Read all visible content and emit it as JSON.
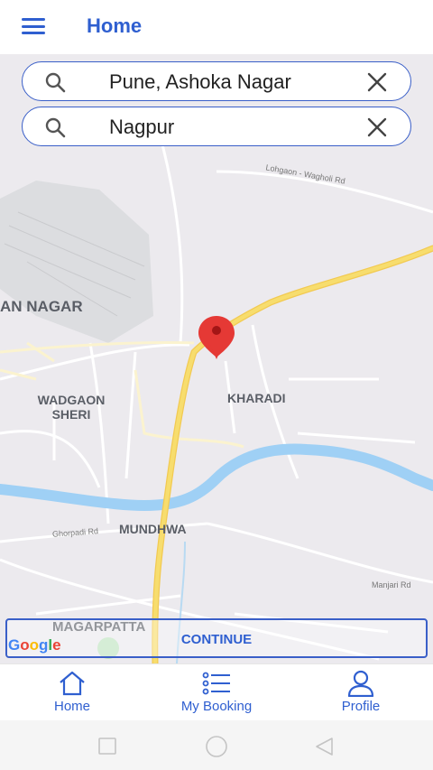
{
  "header": {
    "title": "Home",
    "menu_icon": "hamburger-menu-icon"
  },
  "search": {
    "origin": {
      "value": "Pune, Ashoka Nagar",
      "icon": "search-icon",
      "clear_icon": "close-icon"
    },
    "destination": {
      "value": "Nagpur",
      "icon": "search-icon",
      "clear_icon": "close-icon"
    }
  },
  "map": {
    "labels": {
      "lohgaon": "Lohgaon - Wagholi Rd",
      "an_nagar": "AN NAGAR",
      "wadgaon": "WADGAON SHERI",
      "kharadi": "KHARADI",
      "ghorpadi": "Ghorpadi Rd",
      "mundhwa": "MUNDHWA",
      "manjari": "Manjari Rd",
      "magarpatta": "MAGARPATTA"
    },
    "marker_icon": "map-pin-icon",
    "google_logo": "Google",
    "colors": {
      "highway": "#f7dd6e",
      "river": "#9fd0f5",
      "land": "#eceaee",
      "marker": "#e53935"
    }
  },
  "actions": {
    "continue_label": "CONTINUE"
  },
  "bottom_nav": {
    "items": [
      {
        "label": "Home",
        "icon": "home-icon"
      },
      {
        "label": "My Booking",
        "icon": "list-icon"
      },
      {
        "label": "Profile",
        "icon": "profile-icon"
      }
    ]
  },
  "system_nav": {
    "recent": "square-icon",
    "home": "circle-icon",
    "back": "triangle-back-icon"
  },
  "theme": {
    "accent": "#2f5fd0"
  }
}
